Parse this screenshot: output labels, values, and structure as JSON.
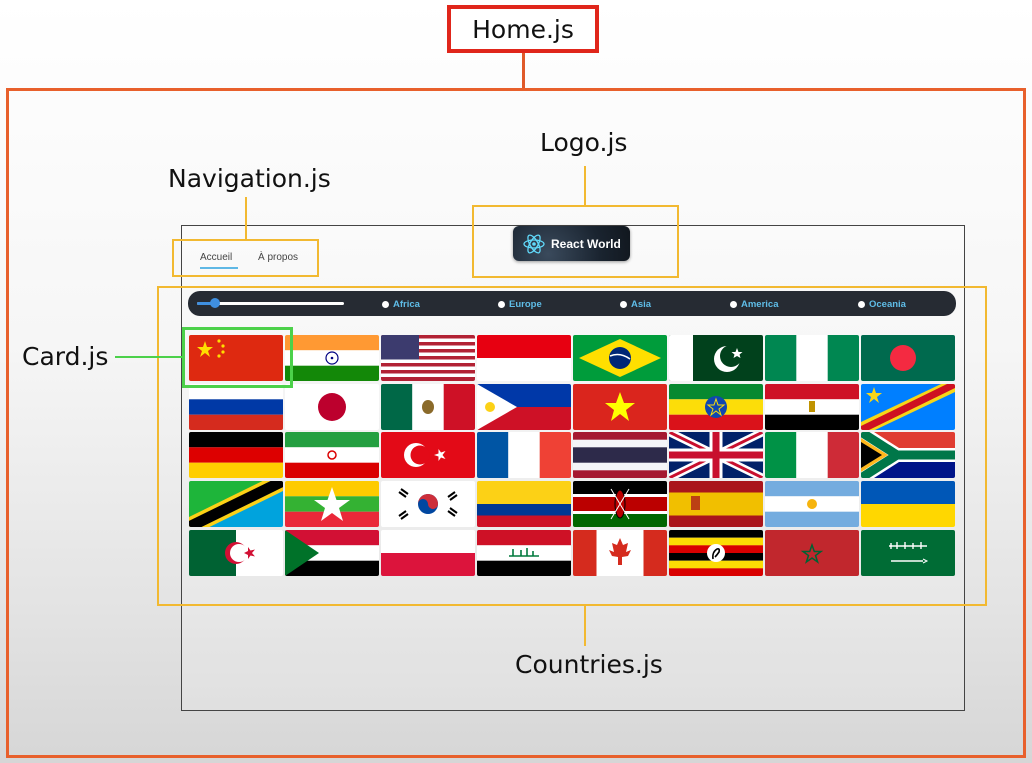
{
  "annotations": {
    "home": "Home.js",
    "logo": "Logo.js",
    "navigation": "Navigation.js",
    "card": "Card.js",
    "countries": "Countries.js"
  },
  "nav": {
    "home_label": "Accueil",
    "about_label": "À propos"
  },
  "logo": {
    "text": "React World",
    "icon": "react-atom-icon"
  },
  "filter": {
    "slider_value": 0.12,
    "regions": [
      "Africa",
      "Europe",
      "Asia",
      "America",
      "Oceania"
    ]
  },
  "flags": [
    "China",
    "India",
    "United States",
    "Indonesia",
    "Brazil",
    "Pakistan",
    "Nigeria",
    "Bangladesh",
    "Russia",
    "Japan",
    "Mexico",
    "Philippines",
    "Vietnam",
    "Ethiopia",
    "Egypt",
    "DR Congo",
    "Germany",
    "Iran",
    "Turkey",
    "France",
    "Thailand",
    "United Kingdom",
    "Italy",
    "South Africa",
    "Tanzania",
    "Myanmar",
    "South Korea",
    "Colombia",
    "Kenya",
    "Spain",
    "Argentina",
    "Ukraine",
    "Algeria",
    "Sudan",
    "Poland",
    "Iraq",
    "Canada",
    "Uganda",
    "Morocco",
    "Saudi Arabia"
  ],
  "colors": {
    "home_border": "#e0261b",
    "home_frame": "#e8602c",
    "component_border": "#f2b931",
    "card_border": "#4cd14a",
    "filter_bar": "#262b33",
    "accent": "#5fbde8"
  }
}
